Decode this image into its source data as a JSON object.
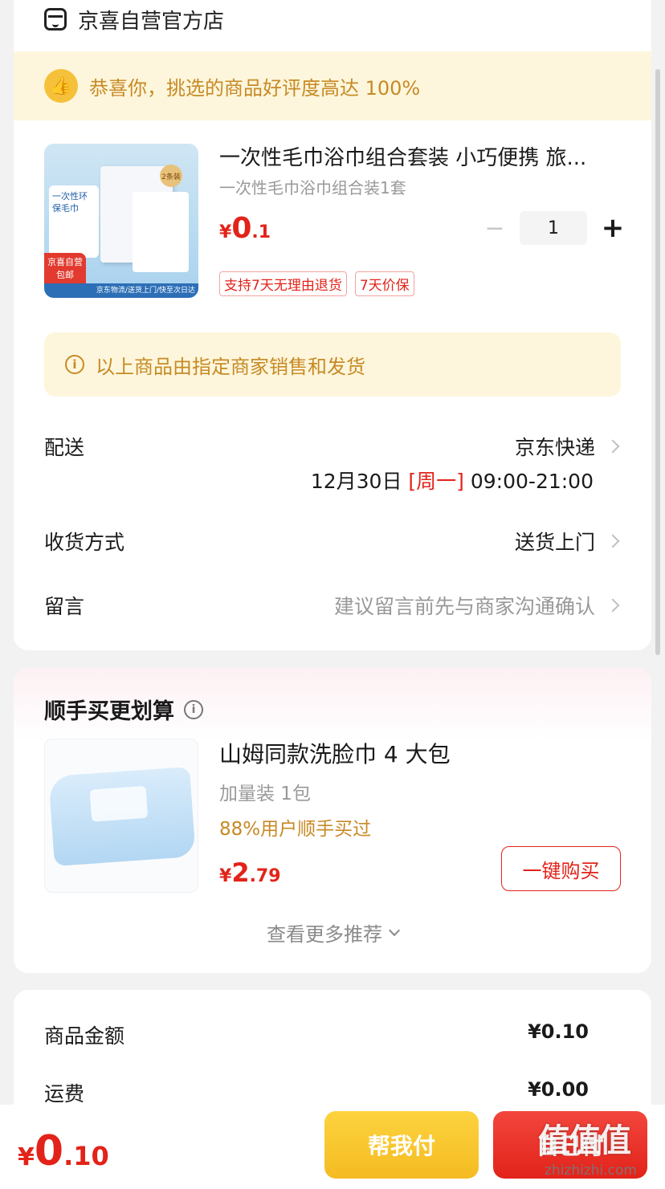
{
  "store": {
    "name": "京喜自营官方店",
    "icon": "store-icon"
  },
  "banner": {
    "text": "恭喜你，挑选的商品好评度高达 100%",
    "icon": "thumbs-up-icon"
  },
  "product": {
    "title": "一次性毛巾浴巾组合套装 小巧便携 旅...",
    "spec": "一次性毛巾浴巾组合装1套",
    "price_yen": "¥",
    "price_int": "0",
    "price_dec": ".1",
    "quantity": "1",
    "tags": [
      "支持7天无理由退货",
      "7天价保"
    ],
    "image": {
      "card_label": "一次性环保毛巾",
      "badge": "2条装",
      "jd_tag_1": "京喜自营",
      "jd_tag_2": "包邮",
      "bottom_bar": "京东物流/送货上门/快至次日达"
    }
  },
  "notice": {
    "text": "以上商品由指定商家销售和发货"
  },
  "delivery": {
    "label": "配送",
    "value": "京东快递",
    "date": "12月30日",
    "weekday": "[周一]",
    "time": "09:00-21:00"
  },
  "receive": {
    "label": "收货方式",
    "value": "送货上门"
  },
  "message": {
    "label": "留言",
    "placeholder": "建议留言前先与商家沟通确认"
  },
  "recommend": {
    "title": "顺手买更划算",
    "item_title": "山姆同款洗脸巾 4 大包",
    "item_spec": "加量装 1包",
    "item_note": "88%用户顺手买过",
    "price_yen": "¥",
    "price_int": "2",
    "price_dec": ".79",
    "buy_label": "一键购买",
    "more_label": "查看更多推荐"
  },
  "summary": [
    {
      "label": "商品金额",
      "value": "¥0.10"
    },
    {
      "label": "运费",
      "value": "¥0.00"
    }
  ],
  "footer": {
    "total_yen": "¥",
    "total_int": "0",
    "total_dec": ".10",
    "help_pay_label": "帮我付",
    "self_pay_label": "自己付"
  },
  "watermark": {
    "logo": "值值值",
    "url": "zhizhizhi.com"
  },
  "colors": {
    "accent_red": "#e2231a",
    "gold": "#c78a25",
    "banner_bg": "#fdf6dc",
    "help_btn": "#f5bb22"
  }
}
